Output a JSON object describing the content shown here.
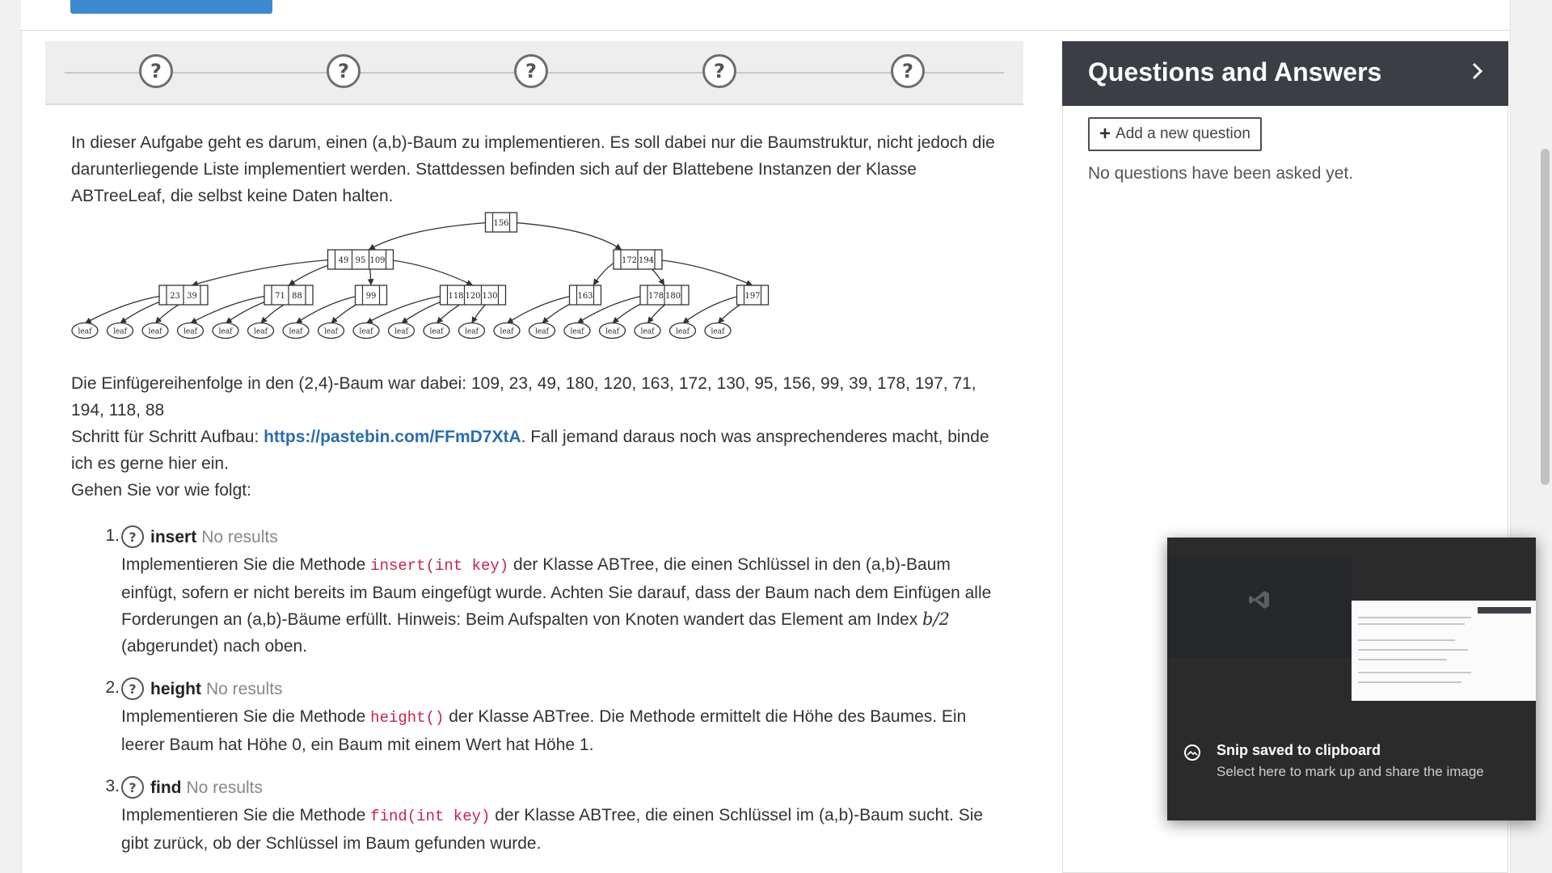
{
  "steps": {
    "items": [
      {
        "symbol": "?"
      },
      {
        "symbol": "?"
      },
      {
        "symbol": "?"
      },
      {
        "symbol": "?"
      },
      {
        "symbol": "?"
      }
    ]
  },
  "intro": {
    "text": "In dieser Aufgabe geht es darum, einen (a,b)-Baum zu implementieren. Es soll dabei nur die Baumstruktur, nicht jedoch die darunterliegende Liste implementiert werden. Stattdessen befinden sich auf der Blattebene Instanzen der Klasse ABTreeLeaf, die selbst keine Daten halten."
  },
  "tree": {
    "root": [
      "156"
    ],
    "level1": [
      [
        "49",
        "95",
        "109"
      ],
      [
        "172",
        "194"
      ]
    ],
    "level2": [
      [
        "23",
        "39"
      ],
      [
        "71",
        "88"
      ],
      [
        "99"
      ],
      [
        "118",
        "120",
        "130"
      ],
      [
        "163"
      ],
      [
        "178",
        "180"
      ],
      [
        "197"
      ]
    ],
    "leaf_label": "leaf",
    "leaf_count": 19
  },
  "sequence": {
    "text": "Die Einfügereihenfolge in den (2,4)-Baum war dabei: 109, 23, 49, 180, 120, 163, 172, 130, 95, 156, 99, 39, 178, 197, 71, 194, 118, 88"
  },
  "build": {
    "prefix": "Schritt für Schritt Aufbau: ",
    "link": "https://pastebin.com/FFmD7XtA",
    "suffix": ". Fall jemand daraus noch was ansprechenderes macht, binde ich es gerne hier ein."
  },
  "instruction": {
    "text": "Gehen Sie vor wie folgt:"
  },
  "tasks": [
    {
      "number": "1.",
      "icon": "?",
      "title": "insert",
      "status": "No results",
      "body_before": "Implementieren Sie die Methode ",
      "code": "insert(int key)",
      "body_after": " der Klasse ABTree, die einen Schlüssel in den (a,b)-Baum einfügt, sofern er nicht bereits im Baum eingefügt wurde. Achten Sie darauf, dass der Baum nach dem Einfügen alle Forderungen an (a,b)-Bäume erfüllt. Hinweis: Beim Aufspalten von Knoten wandert das Element am Index ",
      "math": "b/2",
      "body_end": " (abgerundet) nach oben."
    },
    {
      "number": "2.",
      "icon": "?",
      "title": "height",
      "status": "No results",
      "body_before": "Implementieren Sie die Methode ",
      "code": "height()",
      "body_after": " der Klasse ABTree. Die Methode ermittelt die Höhe des Baumes. Ein leerer Baum hat Höhe 0, ein Baum mit einem Wert hat Höhe 1."
    },
    {
      "number": "3.",
      "icon": "?",
      "title": "find",
      "status": "No results",
      "body_before": "Implementieren Sie die Methode ",
      "code": "find(int key)",
      "body_after": " der Klasse ABTree, die einen Schlüssel im (a,b)-Baum sucht. Sie gibt zurück, ob der Schlüssel im Baum gefunden wurde."
    }
  ],
  "qa": {
    "title": "Questions and Answers",
    "add_label": "Add a new question",
    "empty_text": "No questions have been asked yet."
  },
  "toast": {
    "title": "Snip saved to clipboard",
    "body": "Select here to mark up and share the image"
  },
  "colors": {
    "link": "#2a6db0",
    "code": "#c7254e",
    "qa_header": "#3b3f45",
    "toast_bg": "#2b2b2b"
  }
}
